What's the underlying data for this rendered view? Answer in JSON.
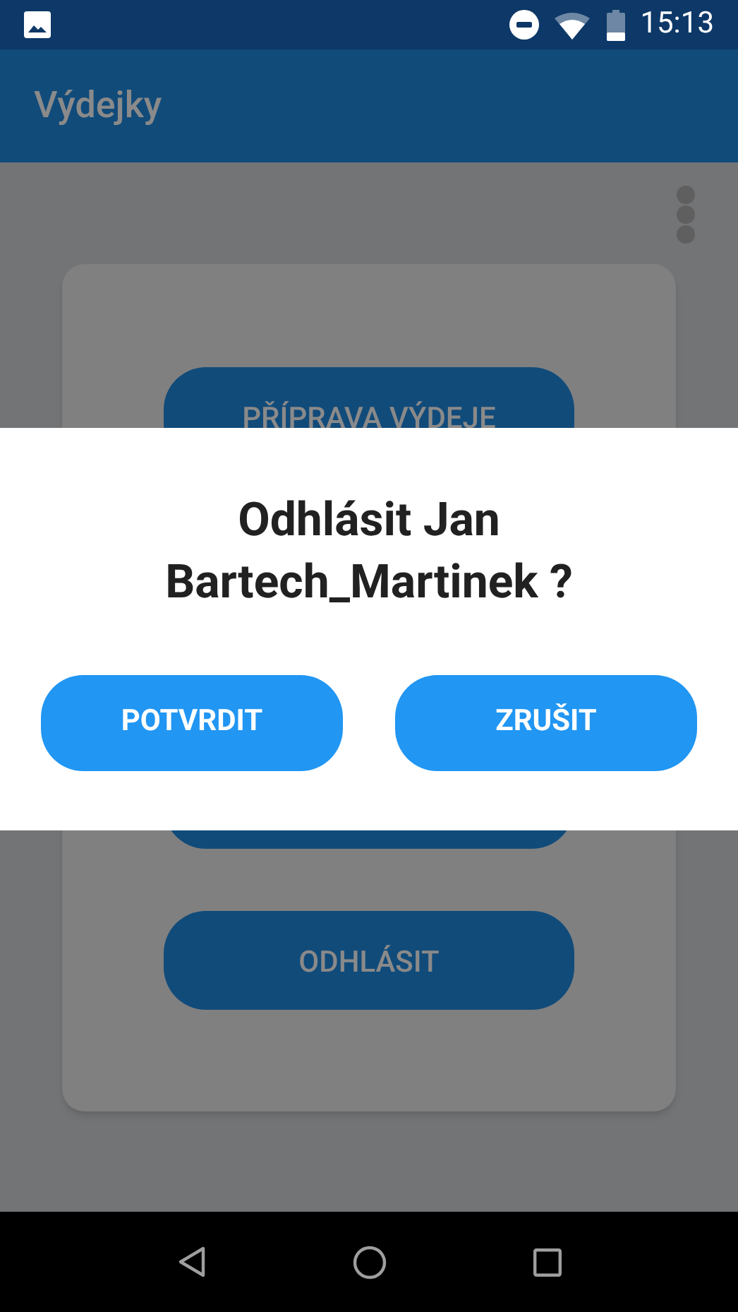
{
  "status_bar": {
    "time": "15:13"
  },
  "app_bar": {
    "title": "Výdejky"
  },
  "card": {
    "buttons": [
      {
        "kind": "labeled",
        "label": "PŘÍPRAVA VÝDEJE"
      },
      {
        "kind": "hidden"
      },
      {
        "kind": "labeled",
        "label": "ODHLÁSIT"
      }
    ]
  },
  "dialog": {
    "title": "Odhlásit Jan Bartech_Martinek ?",
    "buttons": [
      "POTVRDIT",
      "ZRUŠIT"
    ]
  }
}
